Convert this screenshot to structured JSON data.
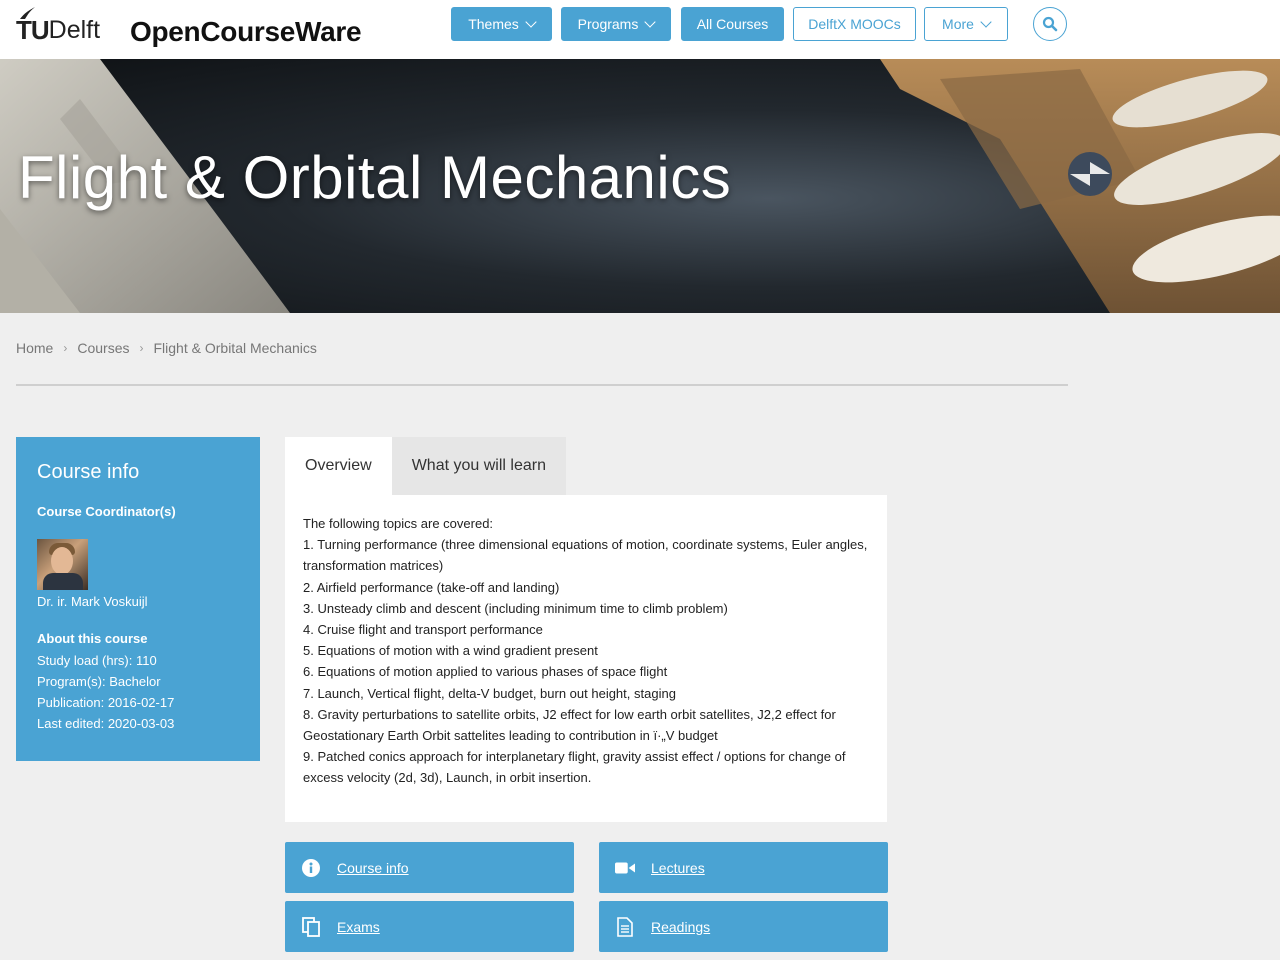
{
  "header": {
    "logo_tu": "TU",
    "logo_delft": "Delft",
    "site_title": "OpenCourseWare",
    "nav": {
      "themes": "Themes",
      "programs": "Programs",
      "all_courses": "All Courses",
      "delftx": "DelftX MOOCs",
      "more": "More"
    },
    "search_icon": "search-icon"
  },
  "banner": {
    "title": "Flight & Orbital Mechanics"
  },
  "breadcrumb": {
    "home": "Home",
    "courses": "Courses",
    "current": "Flight & Orbital Mechanics"
  },
  "course_info": {
    "heading": "Course info",
    "coordinator_label": "Course Coordinator(s)",
    "coordinator_name": "Dr. ir. Mark Voskuijl",
    "about_label": "About this course",
    "study_load": "Study load (hrs): 110",
    "programs": "Program(s): Bachelor",
    "publication": "Publication: 2016-02-17",
    "last_edited": "Last edited: 2020-03-03"
  },
  "tabs": {
    "overview": "Overview",
    "learn": "What you will learn"
  },
  "overview": {
    "intro": "The following topics are covered:",
    "items": [
      "1. Turning performance (three dimensional equations of motion, coordinate systems, Euler angles, transformation matrices)",
      "2. Airfield performance (take-off and landing)",
      "3. Unsteady climb and descent (including minimum time to climb problem)",
      "4. Cruise flight and transport performance",
      "5. Equations of motion with a wind gradient present",
      "6. Equations of motion applied to various phases of space flight",
      "7. Launch, Vertical flight, delta-V budget, burn out height, staging",
      "8. Gravity perturbations to satellite orbits, J2 effect for low earth orbit satellites, J2,2 effect for Geostationary Earth Orbit sattelites leading to contribution in ï·„V budget",
      "9. Patched conics approach for interplanetary flight, gravity assist effect / options for change of excess velocity (2d, 3d), Launch, in orbit insertion."
    ]
  },
  "resources": {
    "course_info": "Course info",
    "lectures": "Lectures",
    "exams": "Exams",
    "readings": "Readings"
  },
  "colors": {
    "accent": "#4aa3d3",
    "page_bg": "#efefef"
  }
}
